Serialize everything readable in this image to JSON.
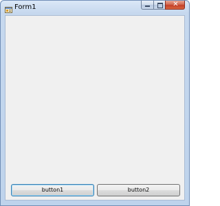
{
  "window": {
    "title": "Form1",
    "icon": "form-app-icon"
  },
  "caption_buttons": {
    "minimize_icon": "minimize-icon",
    "maximize_icon": "maximize-icon",
    "close_glyph": "✕",
    "close_icon": "close-icon"
  },
  "buttons": [
    {
      "label": "button1",
      "state": "focused"
    },
    {
      "label": "button2",
      "state": "normal"
    }
  ],
  "colors": {
    "client_background": "#f0f0f0",
    "close_button": "#c4402a",
    "focus_border": "#3c7fb1"
  }
}
